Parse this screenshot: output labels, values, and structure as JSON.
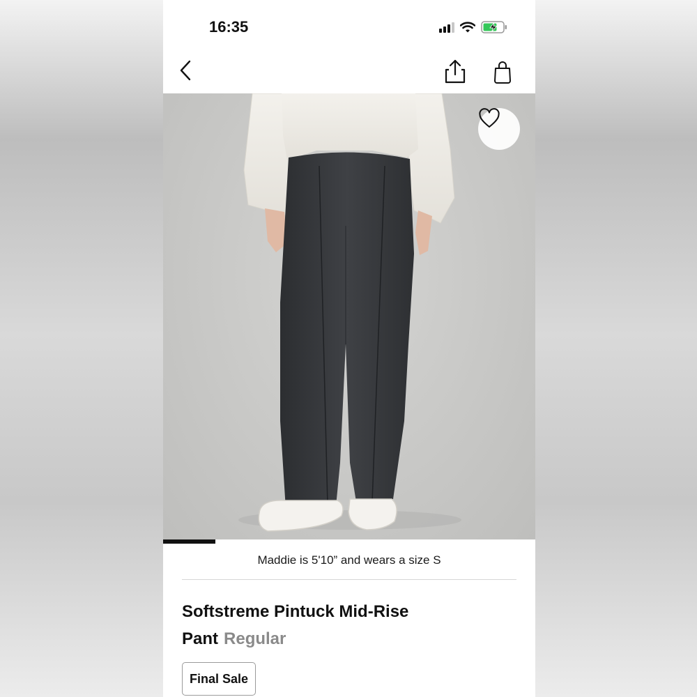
{
  "status_bar": {
    "time": "16:35",
    "icons": [
      "cellular-signal-icon",
      "wifi-icon",
      "battery-charging-icon"
    ],
    "battery_color": "#34c759"
  },
  "nav": {
    "icons": [
      "chevron-left-icon",
      "share-icon",
      "shopping-bag-icon"
    ]
  },
  "hero": {
    "favorite_icon": "heart-outline-icon",
    "carousel_progress": 0.14
  },
  "model_info": "Maddie is 5'10” and wears a size S",
  "product": {
    "name": "Softstreme Pintuck Mid-Rise Pant",
    "variant": "Regular",
    "badge": "Final Sale"
  }
}
